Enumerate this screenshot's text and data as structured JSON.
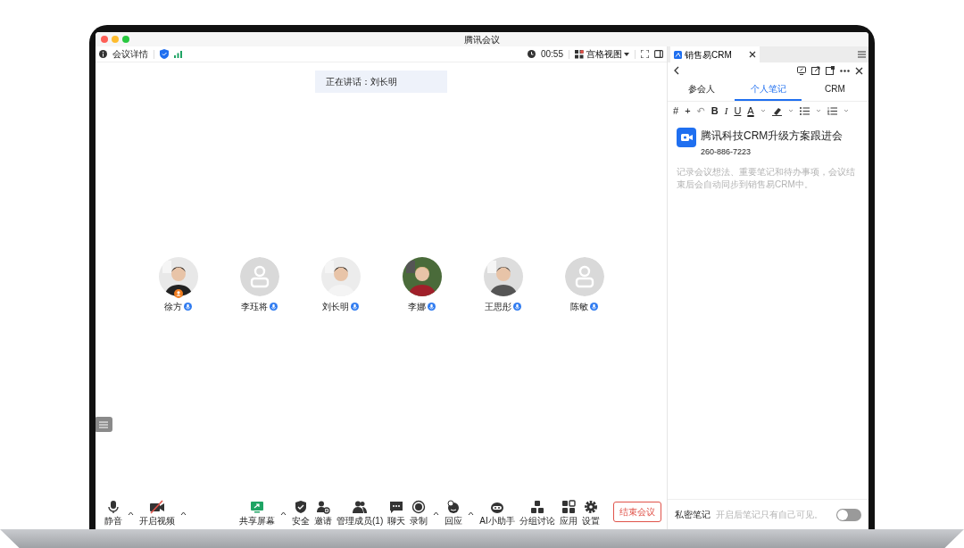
{
  "window": {
    "title": "腾讯会议"
  },
  "toolbar": {
    "meeting_info": "会议详情",
    "timer": "00:55",
    "view": "宫格视图"
  },
  "speaking": "正在讲话：刘长明",
  "participants": [
    {
      "name": "徐方",
      "host": true
    },
    {
      "name": "李珏将",
      "kind": "placeholder",
      "host": false
    },
    {
      "name": "刘长明",
      "host": false
    },
    {
      "name": "李娜",
      "host": false
    },
    {
      "name": "王思彤",
      "host": false
    },
    {
      "name": "陈敏",
      "kind": "placeholder",
      "host": false
    }
  ],
  "controls_left": [
    {
      "label": "静音",
      "kind": "mic",
      "caret": true
    },
    {
      "label": "开启视频",
      "kind": "video",
      "caret": true
    }
  ],
  "controls_center": [
    {
      "label": "共享屏幕",
      "kind": "share",
      "caret": true
    },
    {
      "label": "安全",
      "kind": "shield",
      "caret": false
    },
    {
      "label": "邀请",
      "kind": "invite",
      "caret": false
    },
    {
      "label": "管理成员(1)",
      "kind": "members",
      "caret": false
    },
    {
      "label": "聊天",
      "kind": "chat",
      "caret": false
    },
    {
      "label": "录制",
      "kind": "record",
      "caret": true
    },
    {
      "label": "回应",
      "kind": "reaction",
      "caret": true
    },
    {
      "label": "AI小助手",
      "kind": "bot",
      "caret": false
    },
    {
      "label": "分组讨论",
      "kind": "breakout",
      "caret": false
    },
    {
      "label": "应用",
      "kind": "apps",
      "caret": false
    },
    {
      "label": "设置",
      "kind": "gear",
      "caret": false
    }
  ],
  "end_button": "结束会议",
  "side_panel": {
    "app_tab": "销售易CRM",
    "tabs": [
      {
        "label": "参会人",
        "selected": false
      },
      {
        "label": "个人笔记",
        "selected": true
      },
      {
        "label": "CRM",
        "selected": false
      }
    ],
    "editor_tools": [
      "#",
      "+",
      "↶",
      "B",
      "I",
      "U",
      "A"
    ],
    "meeting_title": "腾讯科技CRM升级方案跟进会",
    "meeting_number": "260-886-7223",
    "placeholder": "记录会议想法、重要笔记和待办事项，会议结束后会自动同步到销售易CRM中。",
    "private_note": {
      "label": "私密笔记",
      "hint": "开启后笔记只有自己可见。",
      "on": false
    }
  }
}
